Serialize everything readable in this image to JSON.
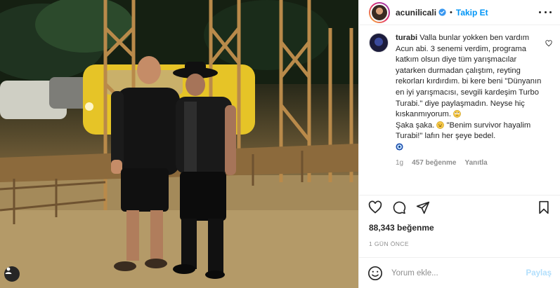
{
  "post": {
    "photo": {
      "alt": ""
    },
    "tag_icon": "person-tag-icon"
  },
  "header": {
    "username": "acunilicali",
    "follow_label": "Takip Et",
    "separator": "•"
  },
  "comments": [
    {
      "username": "turabi",
      "text": "Valla bunlar yokken ben vardım Acun abi. 3 senemi verdim, programa katkım olsun diye tüm yarışmacılar yatarken durmadan çalıştım, reyting rekorları kırdırdım. bi kere beni \"Dünyanın en iyi yarışmacısı, sevgili kardeşim Turbo Turabi.\" diye paylaşmadın. Neyse hiç kıskanmıyorum. ",
      "text2": "\nŞaka şaka. ",
      "text3": " \"Benim survivor hayalim Turabi!\" lafın her şeye bedel.\n",
      "time": "1g",
      "likes": "457 beğenme",
      "reply_label": "Yanıtla"
    }
  ],
  "actions": {
    "like_icon": "heart-icon",
    "comment_icon": "comment-icon",
    "share_icon": "share-icon",
    "save_icon": "bookmark-icon"
  },
  "likes_text": "88,343 beğenme",
  "date_text": "1 GÜN ÖNCE",
  "add_comment": {
    "placeholder": "Yorum ekle...",
    "post_label": "Paylaş"
  },
  "colors": {
    "accent": "#0095f6",
    "post_disabled": "#b2dffc",
    "muted": "#8e8e8e",
    "text": "#262626"
  }
}
